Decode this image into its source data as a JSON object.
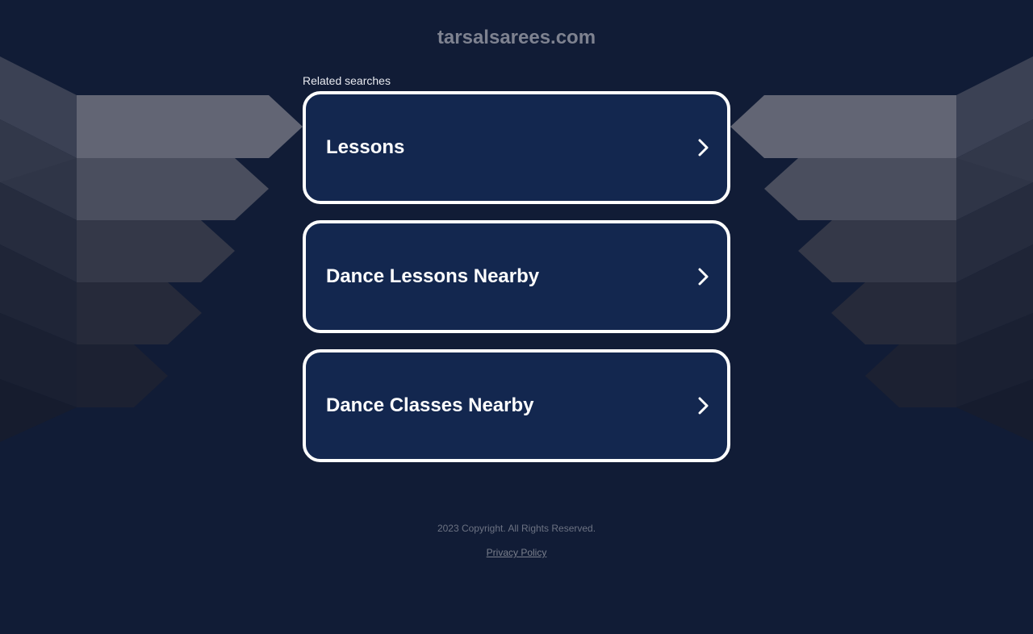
{
  "header": {
    "site_title": "tarsalsarees.com"
  },
  "related": {
    "label": "Related searches",
    "items": [
      {
        "label": "Lessons",
        "icon": "chevron-right-icon"
      },
      {
        "label": "Dance Lessons Nearby",
        "icon": "chevron-right-icon"
      },
      {
        "label": "Dance Classes Nearby",
        "icon": "chevron-right-icon"
      }
    ]
  },
  "footer": {
    "copyright": "2023 Copyright. All Rights Reserved.",
    "privacy_label": "Privacy Policy"
  },
  "colors": {
    "background": "#111c36",
    "card_background": "#13274f",
    "card_border": "#ffffff",
    "title": "#7e8290"
  }
}
